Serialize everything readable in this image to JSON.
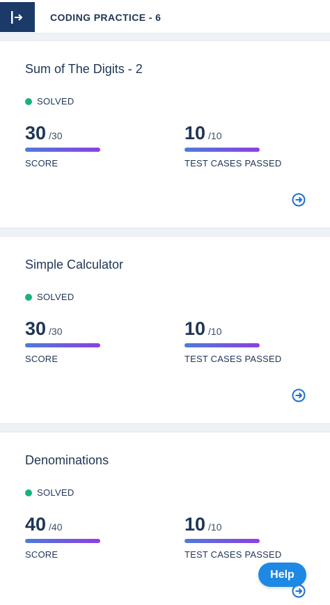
{
  "header": {
    "title": "CODING PRACTICE - 6",
    "toggle_icon": "sidebar-expand-icon"
  },
  "colors": {
    "brand": "#1b3a67",
    "solved": "#18b27a",
    "bar_start": "#4f7bd9",
    "bar_end": "#8b3fe3",
    "help": "#1e88e5"
  },
  "problems": [
    {
      "title": "Sum of The Digits - 2",
      "status": "SOLVED",
      "score": {
        "value": "30",
        "max": "/30",
        "label": "SCORE"
      },
      "tests": {
        "value": "10",
        "max": "/10",
        "label": "TEST CASES PASSED"
      }
    },
    {
      "title": "Simple Calculator",
      "status": "SOLVED",
      "score": {
        "value": "30",
        "max": "/30",
        "label": "SCORE"
      },
      "tests": {
        "value": "10",
        "max": "/10",
        "label": "TEST CASES PASSED"
      }
    },
    {
      "title": "Denominations",
      "status": "SOLVED",
      "score": {
        "value": "40",
        "max": "/40",
        "label": "SCORE"
      },
      "tests": {
        "value": "10",
        "max": "/10",
        "label": "TEST CASES PASSED"
      }
    }
  ],
  "help": {
    "label": "Help"
  }
}
